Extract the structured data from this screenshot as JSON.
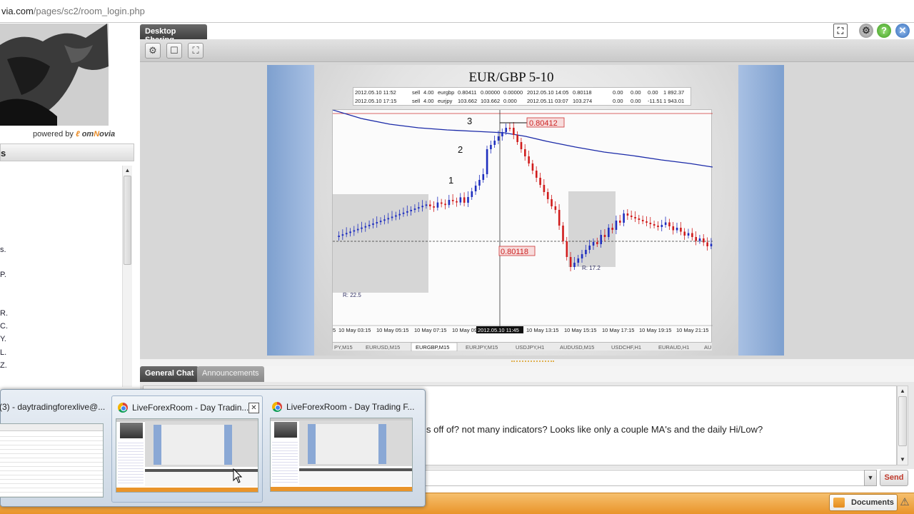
{
  "browser": {
    "url_prefix": "via.com",
    "url_path": "/pages/sc2/room_login.php"
  },
  "left_panel": {
    "powered_by": "powered by",
    "brand_a": "om",
    "brand_b": "N",
    "brand_c": "ovia",
    "header": "s",
    "list_fragments": [
      "s.",
      "P.",
      "R.",
      "C.",
      "Y.",
      "L.",
      "Z."
    ]
  },
  "desktop_sharing": {
    "tab_label": "Desktop Sharing",
    "icons": [
      "expand-icon",
      "gear-icon",
      "help-icon",
      "close-icon"
    ]
  },
  "shared_screen": {
    "chart_title": "EUR/GBP 5-10",
    "trades": [
      [
        "2012.05.10 11:52",
        "sell",
        "4.00",
        "eurgbp",
        "0.80411",
        "0.00000",
        "0.00000",
        "2012.05.10 14:05",
        "0.80118",
        "0.00",
        "0.00",
        "0.00",
        "1 892.37"
      ],
      [
        "2012.05.10 17:15",
        "sell",
        "4.00",
        "eurjpy",
        "103.662",
        "103.662",
        "0.000",
        "2012.05.11 03:07",
        "103.274",
        "0.00",
        "0.00",
        "-11.51",
        "1 943.01"
      ]
    ],
    "wave_labels": [
      "1",
      "2",
      "3"
    ],
    "price_high": "0.80412",
    "price_low": "0.80118",
    "range_left": "R: 22.5",
    "range_right": "R: 17.2",
    "time_labels": [
      "5",
      "10 May 03:15",
      "10 May 05:15",
      "10 May 07:15",
      "10 May 09",
      "2012.05.10 11:45",
      "10 May 13:15",
      "10 May 15:15",
      "10 May 17:15",
      "10 May 19:15",
      "10 May 21:15"
    ],
    "symbol_tabs": [
      "PY,M15",
      "EURUSD,M15",
      "EURGBP,M15",
      "EURJPY,M15",
      "USDJPY,H1",
      "AUDUSD,M15",
      "USDCHF,H1",
      "EURAUD,H1",
      "AU"
    ]
  },
  "chat": {
    "tab_general": "General Chat",
    "tab_announcements": "Announcements",
    "message": "s off of?  not many indicators?  Looks like only a couple MA's and the daily Hi/Low?",
    "send_label": "Send"
  },
  "bottom_bar": {
    "documents_label": "Documents"
  },
  "taskbar_preview": {
    "items": [
      {
        "title": "(3) - daytradingforexlive@..."
      },
      {
        "title": "LiveForexRoom - Day Tradin...",
        "close": "✕"
      },
      {
        "title": "LiveForexRoom - Day Trading F..."
      }
    ]
  },
  "colors": {
    "accent_orange": "#e9942a",
    "chart_bull": "#1f2fbf",
    "chart_bear": "#d01c1c",
    "ma_line": "#1b2aa8"
  }
}
